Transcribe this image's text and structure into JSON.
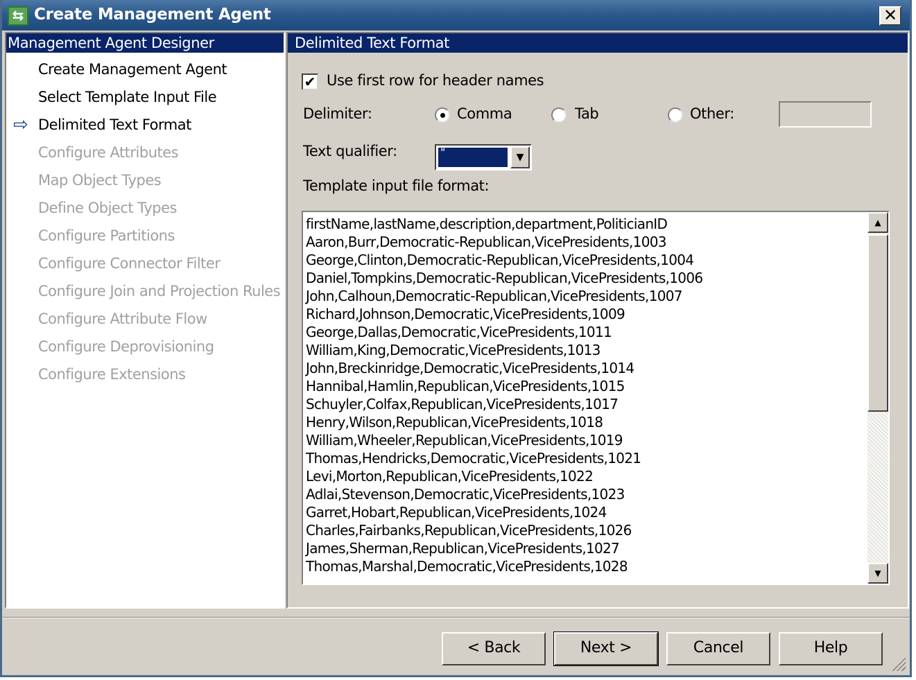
{
  "window": {
    "title": "Create Management Agent",
    "close_label": "✕"
  },
  "left_panel": {
    "header": "Management Agent Designer",
    "items": [
      {
        "label": "Create Management Agent",
        "state": "enabled",
        "current": false
      },
      {
        "label": "Select Template Input File",
        "state": "enabled",
        "current": false
      },
      {
        "label": "Delimited Text Format",
        "state": "enabled",
        "current": true
      },
      {
        "label": "Configure Attributes",
        "state": "disabled",
        "current": false
      },
      {
        "label": "Map Object Types",
        "state": "disabled",
        "current": false
      },
      {
        "label": "Define Object Types",
        "state": "disabled",
        "current": false
      },
      {
        "label": "Configure Partitions",
        "state": "disabled",
        "current": false
      },
      {
        "label": "Configure Connector Filter",
        "state": "disabled",
        "current": false
      },
      {
        "label": "Configure Join and Projection Rules",
        "state": "disabled",
        "current": false
      },
      {
        "label": "Configure Attribute Flow",
        "state": "disabled",
        "current": false
      },
      {
        "label": "Configure Deprovisioning",
        "state": "disabled",
        "current": false
      },
      {
        "label": "Configure Extensions",
        "state": "disabled",
        "current": false
      }
    ]
  },
  "right_panel": {
    "header": "Delimited Text Format",
    "use_header_row": {
      "label": "Use first row for header names",
      "checked": true
    },
    "delimiter": {
      "label": "Delimiter:",
      "options": [
        "Comma",
        "Tab",
        "Other:"
      ],
      "selected": "Comma",
      "other_value": ""
    },
    "text_qualifier": {
      "label": "Text qualifier:",
      "value": "\""
    },
    "template_format": {
      "label": "Template input file format:",
      "lines": [
        "firstName,lastName,description,department,PoliticianID",
        "Aaron,Burr,Democratic-Republican,VicePresidents,1003",
        "George,Clinton,Democratic-Republican,VicePresidents,1004",
        "Daniel,Tompkins,Democratic-Republican,VicePresidents,1006",
        "John,Calhoun,Democratic-Republican,VicePresidents,1007",
        "Richard,Johnson,Democratic,VicePresidents,1009",
        "George,Dallas,Democratic,VicePresidents,1011",
        "William,King,Democratic,VicePresidents,1013",
        "John,Breckinridge,Democratic,VicePresidents,1014",
        "Hannibal,Hamlin,Republican,VicePresidents,1015",
        "Schuyler,Colfax,Republican,VicePresidents,1017",
        "Henry,Wilson,Republican,VicePresidents,1018",
        "William,Wheeler,Republican,VicePresidents,1019",
        "Thomas,Hendricks,Democratic,VicePresidents,1021",
        "Levi,Morton,Republican,VicePresidents,1022",
        "Adlai,Stevenson,Democratic,VicePresidents,1023",
        "Garret,Hobart,Republican,VicePresidents,1024",
        "Charles,Fairbanks,Republican,VicePresidents,1026",
        "James,Sherman,Republican,VicePresidents,1027",
        "Thomas,Marshal,Democratic,VicePresidents,1028"
      ]
    }
  },
  "footer": {
    "back": "< Back",
    "next": "Next >",
    "cancel": "Cancel",
    "help": "Help"
  },
  "colors": {
    "title_bar": "#1c4a7d",
    "panel_header": "#0a246a",
    "dialog_bg": "#d4d0c8",
    "disabled_text": "#a0a0a0"
  }
}
